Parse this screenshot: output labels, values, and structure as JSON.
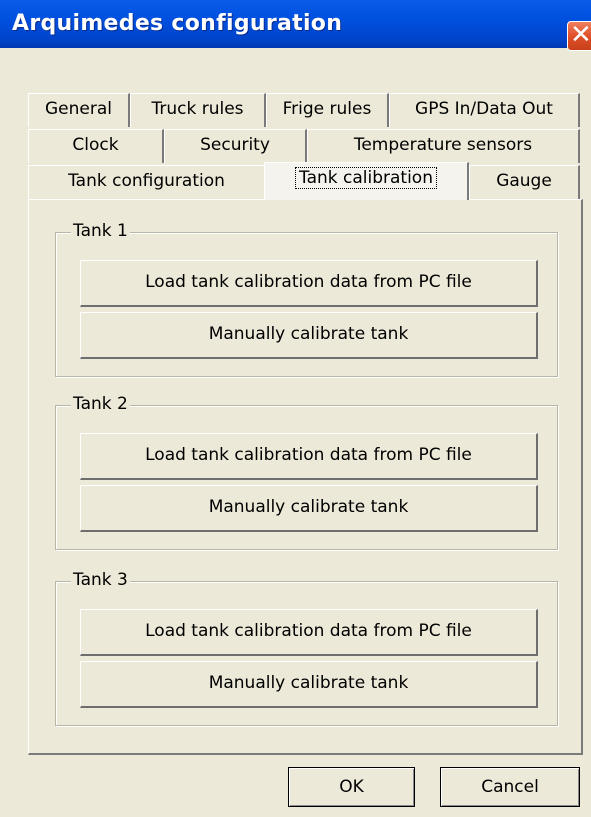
{
  "window": {
    "title": "Arquimedes configuration",
    "close_label": "✕"
  },
  "tabs": {
    "row1": [
      "General",
      "Truck rules",
      "Frige rules",
      "GPS In/Data Out"
    ],
    "row2": [
      "Clock",
      "Security",
      "Temperature sensors"
    ],
    "row3": [
      "Tank configuration",
      "Tank calibration",
      "Gauge"
    ],
    "active": "Tank calibration"
  },
  "tanks": [
    {
      "label": "Tank 1",
      "load_label": "Load tank calibration data from PC file",
      "manual_label": "Manually calibrate tank"
    },
    {
      "label": "Tank 2",
      "load_label": "Load tank calibration data from PC file",
      "manual_label": "Manually calibrate tank"
    },
    {
      "label": "Tank 3",
      "load_label": "Load tank calibration data from PC file",
      "manual_label": "Manually calibrate tank"
    }
  ],
  "footer": {
    "ok_label": "OK",
    "cancel_label": "Cancel"
  },
  "colors": {
    "titlebar": "#0050e0",
    "face": "#ece9d8",
    "close": "#e0502a"
  }
}
